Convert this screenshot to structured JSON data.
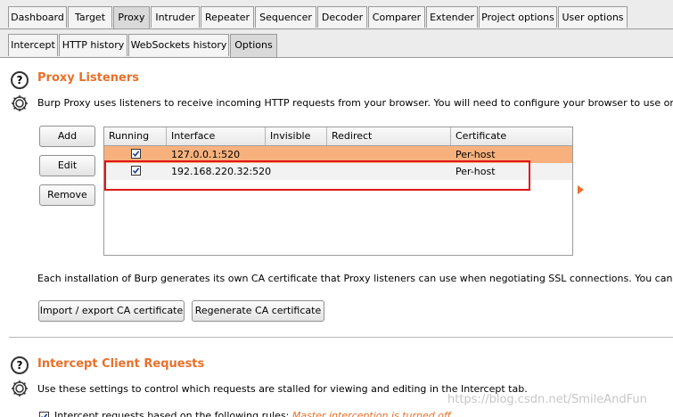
{
  "main_tabs": [
    "Dashboard",
    "Target",
    "Proxy",
    "Intruder",
    "Repeater",
    "Sequencer",
    "Decoder",
    "Comparer",
    "Extender",
    "Project options",
    "User options"
  ],
  "active_main_tab": "Proxy",
  "sub_tabs": [
    "Intercept",
    "HTTP history",
    "WebSockets history",
    "Options"
  ],
  "active_sub_tab": "Options",
  "proxy_listeners": {
    "title": "Proxy Listeners",
    "description": "Burp Proxy uses listeners to receive incoming HTTP requests from your browser. You will need to configure your browser to use one of the listene",
    "buttons": {
      "add": "Add",
      "edit": "Edit",
      "remove": "Remove"
    },
    "columns": [
      "Running",
      "Interface",
      "Invisible",
      "Redirect",
      "Certificate"
    ],
    "rows": [
      {
        "running": true,
        "interface": "127.0.0.1:520",
        "invisible": "",
        "redirect": "",
        "certificate": "Per-host"
      },
      {
        "running": true,
        "interface": "192.168.220.32:520",
        "invisible": "",
        "redirect": "",
        "certificate": "Per-host"
      }
    ]
  },
  "ca": {
    "description": "Each installation of Burp generates its own CA certificate that Proxy listeners can use when negotiating SSL connections. You can import or export",
    "import_export": "Import / export CA certificate",
    "regenerate": "Regenerate CA certificate"
  },
  "intercept_client": {
    "title": "Intercept Client Requests",
    "description": "Use these settings to control which requests are stalled for viewing and editing in the Intercept tab.",
    "checkbox_label": "Intercept requests based on the following rules:",
    "master_note": "Master interception is turned off"
  },
  "watermark": "https://blog.csdn.net/SmileAndFun",
  "colors": {
    "accent": "#e8702a",
    "selected_row": "#f8b17d",
    "highlight_box": "#e01515"
  }
}
